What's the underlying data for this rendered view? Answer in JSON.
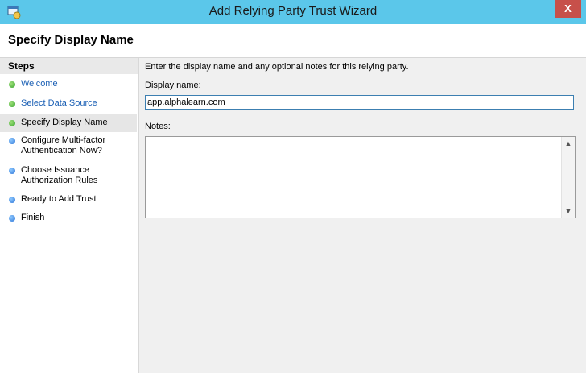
{
  "window": {
    "title": "Add Relying Party Trust Wizard",
    "close_glyph": "X",
    "app_icon": "wizard-app-icon"
  },
  "header": {
    "title": "Specify Display Name"
  },
  "steps": {
    "heading": "Steps",
    "items": [
      {
        "label": "Welcome",
        "status": "complete"
      },
      {
        "label": "Select Data Source",
        "status": "complete"
      },
      {
        "label": "Specify Display Name",
        "status": "current"
      },
      {
        "label": "Configure Multi-factor Authentication Now?",
        "status": "pending"
      },
      {
        "label": "Choose Issuance Authorization Rules",
        "status": "pending"
      },
      {
        "label": "Ready to Add Trust",
        "status": "pending"
      },
      {
        "label": "Finish",
        "status": "pending"
      }
    ]
  },
  "form": {
    "instructions": "Enter the display name and any optional notes for this relying party.",
    "display_name_label": "Display name:",
    "display_name_value": "app.alphalearn.com",
    "notes_label": "Notes:",
    "notes_value": ""
  },
  "colors": {
    "titlebar": "#5bc7ea",
    "close": "#c7504a",
    "step_complete": "#33a22b",
    "step_pending": "#2a72d6",
    "link": "#1a5fb4"
  }
}
